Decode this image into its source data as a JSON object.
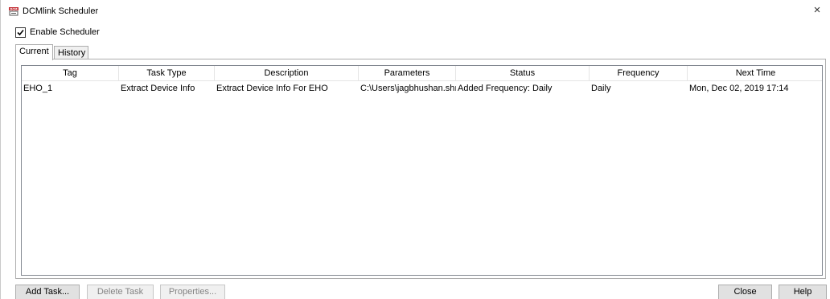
{
  "window": {
    "title": "DCMlink Scheduler",
    "close_glyph": "×",
    "icon": "dcm-app-icon",
    "icon_color": "#c0262c"
  },
  "enable_scheduler": {
    "label": "Enable Scheduler",
    "checked": true
  },
  "tabs": [
    {
      "label": "Current",
      "active": true
    },
    {
      "label": "History",
      "active": false
    }
  ],
  "table": {
    "columns": [
      "Tag",
      "Task Type",
      "Description",
      "Parameters",
      "Status",
      "Frequency",
      "Next Time"
    ],
    "rows": [
      [
        "EHO_1",
        "Extract Device Info",
        "Extract Device Info For EHO",
        "C:\\Users\\jagbhushan.shı",
        "Added Frequency: Daily",
        "Daily",
        "Mon, Dec 02, 2019 17:14"
      ]
    ]
  },
  "buttons": {
    "add_task": "Add Task...",
    "delete_task": "Delete Task",
    "properties": "Properties...",
    "close": "Close",
    "help": "Help"
  }
}
